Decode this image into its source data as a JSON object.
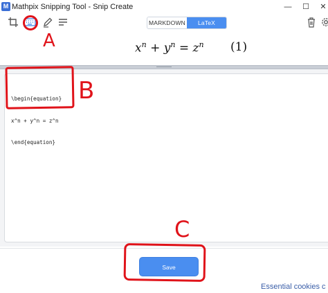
{
  "window": {
    "title": "Mathpix Snipping Tool - Snip Create",
    "logo_text": "M",
    "minimize": "—",
    "maximize": "☐",
    "close": "✕"
  },
  "toolbar": {
    "tabs": [
      "MARKDOWN",
      "LaTeX"
    ],
    "active_tab": "LaTeX"
  },
  "preview": {
    "equation_number": "(1)"
  },
  "editor": {
    "lines": [
      "\\begin{equation}",
      "x^n + y^n = z^n",
      "\\end{equation}"
    ]
  },
  "footer": {
    "save_label": "Save",
    "cookies_text": "Essential cookies c"
  },
  "annotations": {
    "labels": [
      "A",
      "B",
      "C"
    ],
    "color": "#e0131a"
  },
  "colors": {
    "accent": "#4a8ef0",
    "divider": "#c9ced6"
  }
}
